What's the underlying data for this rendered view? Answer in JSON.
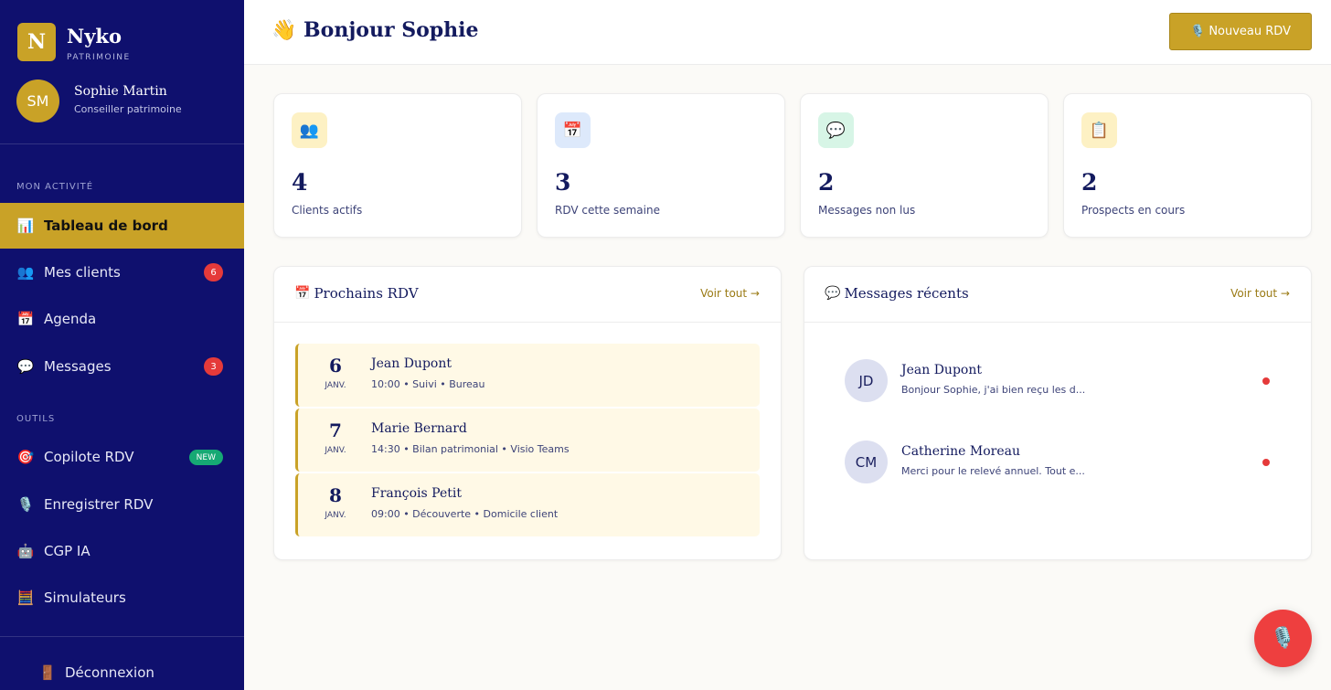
{
  "brand": {
    "logo_letter": "N",
    "name": "Nyko",
    "subtitle": "PATRIMOINE"
  },
  "user": {
    "initials": "SM",
    "name": "Sophie Martin",
    "role": "Conseiller patrimoine"
  },
  "sidebar": {
    "section_activity": "MON ACTIVITÉ",
    "section_tools": "OUTILS",
    "items": [
      {
        "icon": "📊",
        "label": "Tableau de bord",
        "active": true
      },
      {
        "icon": "👥",
        "label": "Mes clients",
        "badge": "6"
      },
      {
        "icon": "📅",
        "label": "Agenda"
      },
      {
        "icon": "💬",
        "label": "Messages",
        "badge": "3"
      },
      {
        "icon": "🎯",
        "label": "Copilote RDV",
        "badge": "NEW"
      },
      {
        "icon": "🎙️",
        "label": "Enregistrer RDV"
      },
      {
        "icon": "🤖",
        "label": "CGP IA"
      },
      {
        "icon": "🧮",
        "label": "Simulateurs"
      }
    ],
    "logout": {
      "icon": "🚪",
      "label": "Déconnexion"
    }
  },
  "header": {
    "greeting": "👋 Bonjour  Sophie",
    "new_rdv": "🎙️ Nouveau RDV"
  },
  "stats": [
    {
      "icon": "👥",
      "value": "4",
      "label": "Clients actifs",
      "color": "#fdf1c4"
    },
    {
      "icon": "📅",
      "value": "3",
      "label": "RDV cette semaine",
      "color": "#dde9fb"
    },
    {
      "icon": "💬",
      "value": "2",
      "label": "Messages non lus",
      "color": "#d7f5e6"
    },
    {
      "icon": "📋",
      "value": "2",
      "label": "Prospects en cours",
      "color": "#fdf1c4"
    }
  ],
  "rdv_panel": {
    "icon": "📅",
    "title": "Prochains RDV",
    "see_all": "Voir tout →",
    "items": [
      {
        "day": "6",
        "month": "JANV.",
        "name": "Jean Dupont",
        "detail": "10:00 • Suivi • Bureau"
      },
      {
        "day": "7",
        "month": "JANV.",
        "name": "Marie Bernard",
        "detail": "14:30 • Bilan patrimonial • Visio Teams"
      },
      {
        "day": "8",
        "month": "JANV.",
        "name": "François Petit",
        "detail": "09:00 • Découverte • Domicile client"
      }
    ]
  },
  "msg_panel": {
    "icon": "💬",
    "title": "Messages récents",
    "see_all": "Voir tout →",
    "items": [
      {
        "initials": "JD",
        "name": "Jean Dupont",
        "text": "Bonjour Sophie, j'ai bien reçu les d..."
      },
      {
        "initials": "CM",
        "name": "Catherine Moreau",
        "text": "Merci pour le relevé annuel. Tout e..."
      }
    ]
  },
  "fab_icon": "🎙️",
  "colors": {
    "sidebar": "#0f106e",
    "accent": "#c9a227",
    "alert": "#e53a3a",
    "new": "#16a974"
  }
}
